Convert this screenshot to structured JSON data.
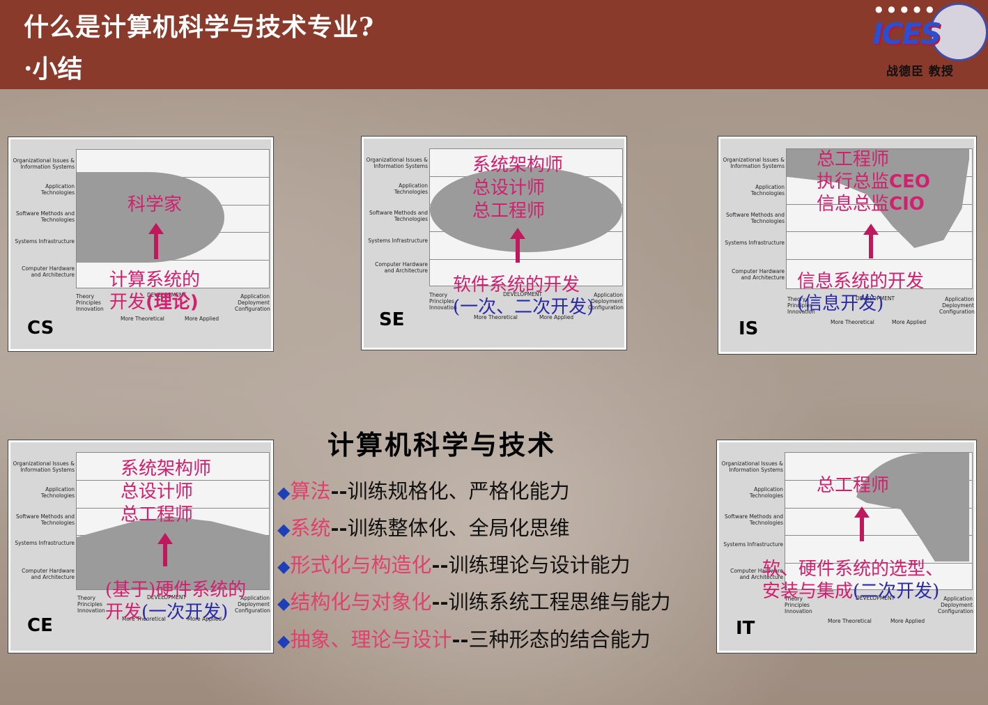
{
  "header": {
    "title": "什么是计算机科学与技术专业?",
    "subtitle": "·小结",
    "logo_text": "ICES",
    "author": "战德臣 教授"
  },
  "panel_labels": {
    "rows": [
      "Organizational Issues & Information Systems",
      "Application Technologies",
      "Software Methods and Technologies",
      "Systems Infrastructure",
      "Computer Hardware and Architecture"
    ],
    "left_bottom": "Theory Principles Innovation",
    "right_bottom": "Application Deployment Configuration",
    "development": "DEVELOPMENT",
    "more_theoretical": "More Theoretical",
    "more_applied": "More Applied"
  },
  "panels": {
    "cs": {
      "code": "CS",
      "top_text": "科学家",
      "bottom_line1": "计算系统的",
      "bottom_line2_a": "开发",
      "bottom_line2_b": "(理论)"
    },
    "se": {
      "code": "SE",
      "top_line1": "系统架构师",
      "top_line2": "总设计师",
      "top_line3": "总工程师",
      "bottom_line1": "软件系统的开发",
      "bottom_line2": "(一次、二次开发)"
    },
    "is": {
      "code": "IS",
      "top_line1": "总工程师",
      "top_line2_a": "执行总监",
      "top_line2_b": "CEO",
      "top_line3_a": "信息总监",
      "top_line3_b": "CIO",
      "bottom_line1": "信息系统的开发",
      "bottom_line2": "(信息开发)"
    },
    "ce": {
      "code": "CE",
      "top_line1": "系统架构师",
      "top_line2": "总设计师",
      "top_line3": "总工程师",
      "bottom_line1": "(基于)硬件系统的",
      "bottom_line2_a": "开发",
      "bottom_line2_b": "(一次开发)"
    },
    "it": {
      "code": "IT",
      "top_text": "总工程师",
      "bottom_line1": "软、硬件系统的选型、",
      "bottom_line2_a": "安装与集成",
      "bottom_line2_b": "(二次开发)"
    }
  },
  "main": {
    "heading": "计算机科学与技术",
    "bullets": [
      {
        "key": "算法",
        "dash": "--",
        "text": "训练规格化、严格化能力"
      },
      {
        "key": "系统",
        "dash": "--",
        "text": "训练整体化、全局化思维"
      },
      {
        "key": "形式化与构造化",
        "dash": "--",
        "text": "训练理论与设计能力"
      },
      {
        "key": "结构化与对象化",
        "dash": "--",
        "text": "训练系统工程思维与能力"
      },
      {
        "key": "抽象、理论与设计",
        "dash": "--",
        "text": "三种形态的结合能力"
      }
    ]
  },
  "colors": {
    "header_bg": "#8a3a2a",
    "accent_pink": "#d0206e",
    "accent_blue": "#2a2aa8",
    "bullet_blue": "#1f3fb8"
  }
}
